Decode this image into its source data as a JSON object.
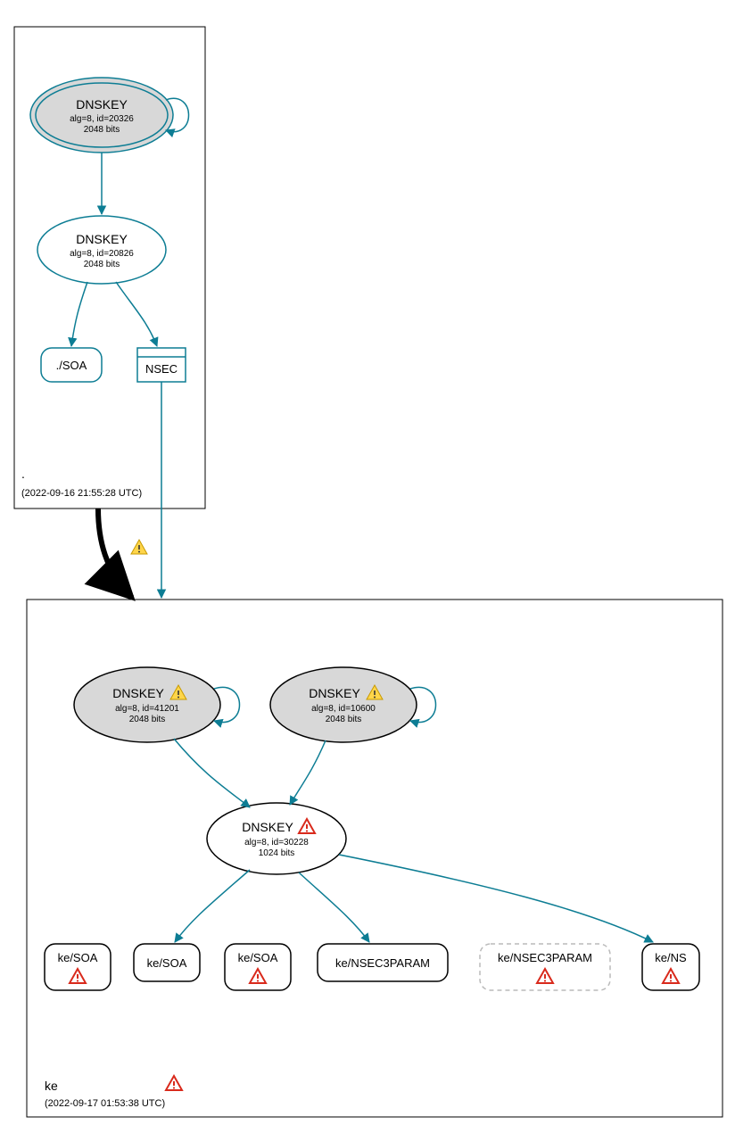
{
  "colors": {
    "teal": "#0d7d94",
    "black": "#000000",
    "grey_fill": "#d8d8d8",
    "warn_yellow": "#ffd54a",
    "error_red": "#d92a1c",
    "dashed_grey": "#bababa"
  },
  "zones": {
    "root": {
      "label": ".",
      "timestamp": "(2022-09-16 21:55:28 UTC)"
    },
    "ke": {
      "label": "ke",
      "timestamp": "(2022-09-17 01:53:38 UTC)"
    }
  },
  "nodes": {
    "root_key_20326": {
      "title": "DNSKEY",
      "line1": "alg=8, id=20326",
      "line2": "2048 bits"
    },
    "root_key_20826": {
      "title": "DNSKEY",
      "line1": "alg=8, id=20826",
      "line2": "2048 bits"
    },
    "root_soa": {
      "label": "./SOA"
    },
    "root_nsec": {
      "label": "NSEC"
    },
    "ke_key_41201": {
      "title": "DNSKEY",
      "line1": "alg=8, id=41201",
      "line2": "2048 bits"
    },
    "ke_key_10600": {
      "title": "DNSKEY",
      "line1": "alg=8, id=10600",
      "line2": "2048 bits"
    },
    "ke_key_30228": {
      "title": "DNSKEY",
      "line1": "alg=8, id=30228",
      "line2": "1024 bits"
    },
    "ke_soa1": {
      "label": "ke/SOA"
    },
    "ke_soa2": {
      "label": "ke/SOA"
    },
    "ke_soa3": {
      "label": "ke/SOA"
    },
    "ke_nsec3a": {
      "label": "ke/NSEC3PARAM"
    },
    "ke_nsec3b": {
      "label": "ke/NSEC3PARAM"
    },
    "ke_ns": {
      "label": "ke/NS"
    }
  },
  "icons": {
    "warning": "warning-icon",
    "error": "error-icon"
  }
}
